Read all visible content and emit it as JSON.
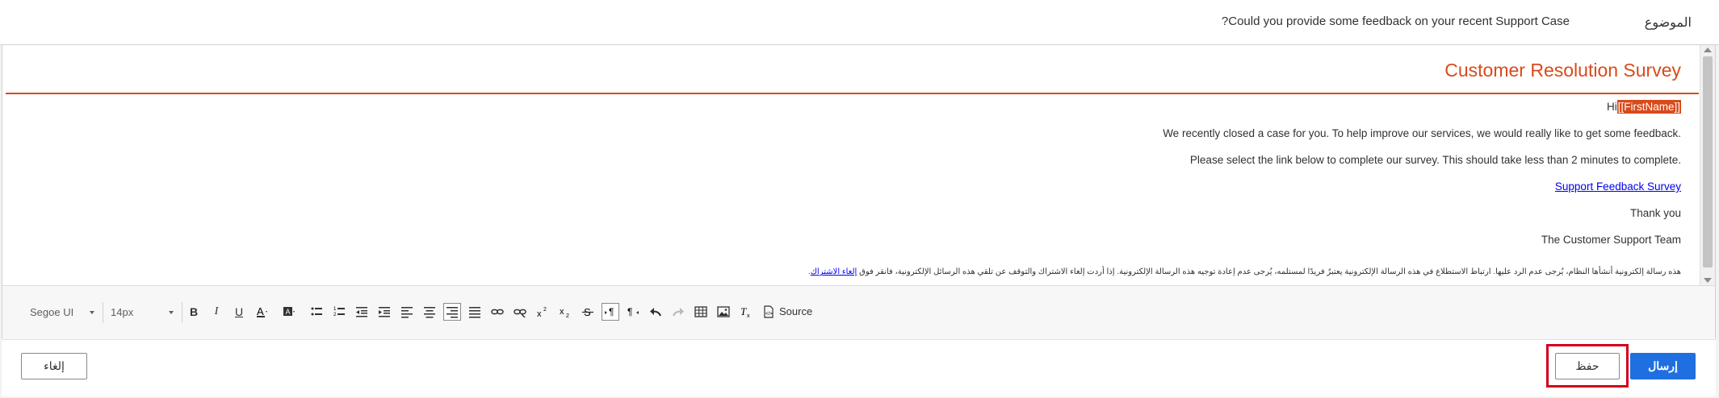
{
  "subject": {
    "label": "الموضوع",
    "value": "Could you provide some feedback on your recent Support Case?"
  },
  "email": {
    "title": "Customer Resolution Survey",
    "greeting_prefix": "Hi",
    "token": "[[FirstName]]",
    "paragraph1": "We recently closed a case for you. To help improve our services, we would really like to get some feedback.",
    "paragraph2": "Please select the link below to complete our survey. This should take less than 2 minutes to complete.",
    "link_text": "Support Feedback Survey",
    "closing": "Thank you",
    "signature": "The Customer Support Team",
    "footer_text": "هذه رسالة إلكترونية أنشأها النظام، يُرجى عدم الرد عليها. ارتباط الاستطلاع في هذه الرسالة الإلكترونية يعتبرٌ فريدًا لمستلمه، يُرجى عدم إعادة توجيه هذه الرسالة الإلكترونية. إذا أردت إلغاء الاشتراك والتوقف عن تلقي هذه الرسائل الإلكترونية، فانقر فوق",
    "unsubscribe_link": "إلغاء الاشتراك"
  },
  "toolbar": {
    "font_family": "Segoe UI",
    "font_size": "14px",
    "source_label": "Source"
  },
  "footer": {
    "cancel_label": "إلغاء",
    "save_label": "حفظ",
    "send_label": "إرسال"
  },
  "colors": {
    "accent": "#d84a1b",
    "primary": "#1f6fe0",
    "highlight": "#d0011b"
  }
}
